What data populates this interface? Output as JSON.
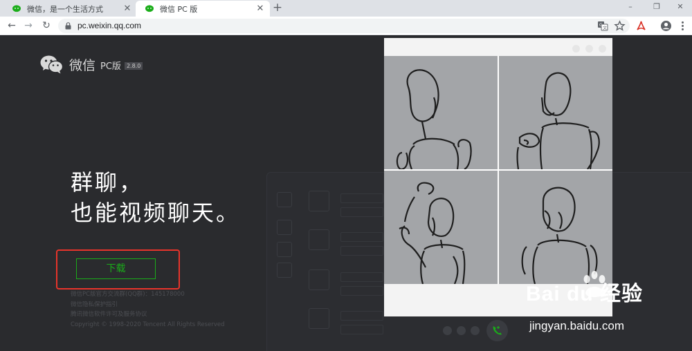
{
  "browser": {
    "tabs": [
      {
        "title": "微信，是一个生活方式",
        "close": "✕",
        "active": false
      },
      {
        "title": "微信 PC 版",
        "close": "✕",
        "active": true
      }
    ],
    "new_tab": "+",
    "window_controls": {
      "minimize": "–",
      "maximize": "❐",
      "close": "✕"
    },
    "nav": {
      "back": "←",
      "forward": "→",
      "reload": "↻"
    },
    "address": "pc.weixin.qq.com",
    "toolbar_icons": [
      "translate-icon",
      "bookmark-star-icon",
      "pdf-extension-icon",
      "account-icon",
      "menu-icon"
    ]
  },
  "page": {
    "brand": "微信",
    "edition": "PC版",
    "version": "2.8.0",
    "headline_1": "群聊，",
    "headline_2": "也能视频聊天。",
    "download_label": "下载",
    "footer": [
      "微信PC版官方交流群(QQ群)：145178000",
      "微信隐私保护指引",
      "腾讯微信软件许可及服务协议",
      "Copyright © 1998-2020 Tencent All Rights Reserved"
    ],
    "accent_color": "#1aad19",
    "highlight_color": "#e8342b"
  },
  "watermark": {
    "text": "Bai du 经验",
    "url": "jingyan.baidu.com"
  }
}
